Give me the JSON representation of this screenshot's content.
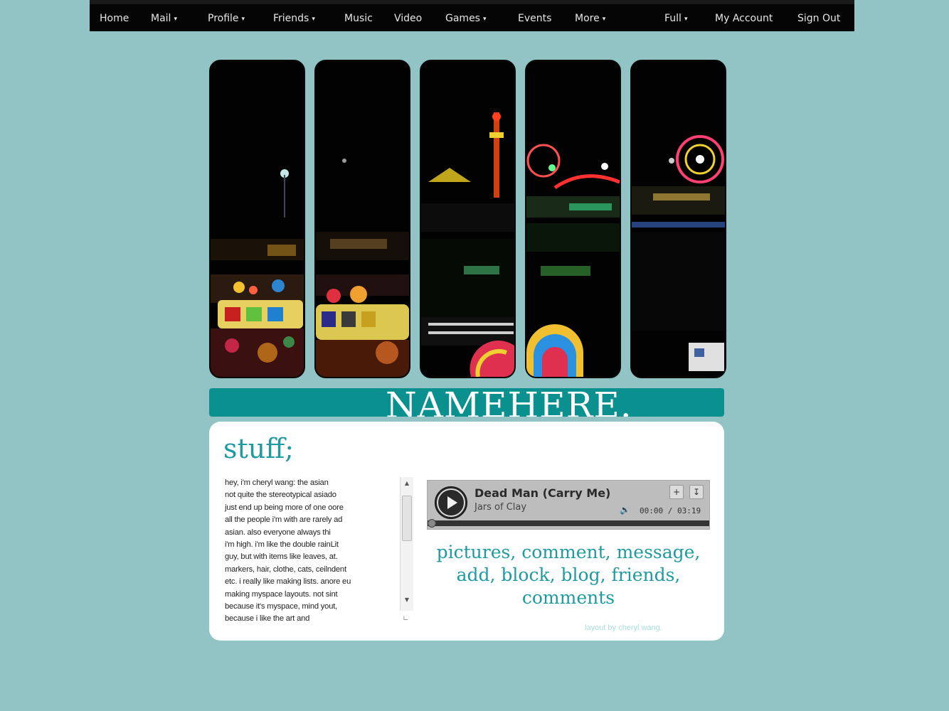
{
  "nav": {
    "left_items": [
      {
        "label": "Home",
        "caret": ""
      },
      {
        "label": "Mail",
        "caret": "▾"
      },
      {
        "label": "Profile",
        "caret": "▾"
      },
      {
        "label": "Friends",
        "caret": "▾"
      },
      {
        "label": "Music",
        "caret": ""
      },
      {
        "label": "Video",
        "caret": ""
      },
      {
        "label": "Games",
        "caret": "▾"
      },
      {
        "label": "Events",
        "caret": ""
      },
      {
        "label": "More",
        "caret": "▾"
      }
    ],
    "right_items": [
      {
        "label": "Full",
        "caret": "▾"
      },
      {
        "label": "My Account",
        "caret": ""
      },
      {
        "label": "Sign Out",
        "caret": ""
      }
    ]
  },
  "banner": {
    "name": "NAMEHERE."
  },
  "panel": {
    "heading": "stuff;",
    "about_text": "hey, i'm cheryl wang: the asian\nnot quite the stereotypical asiado\njust end up being more of one oore\nall the people i'm with are rarely ad\nasian. also everyone always thi\ni'm high. i'm like the double rainLit\nguy, but with items like leaves, at.\nmarkers, hair, clothe, cats, ceilndent\netc. i really like making lists. anore eu\nmaking myspace layouts. not    sint\nbecause it's myspace, mind yout,\nbecause i like the art and",
    "credit": "layout by cheryl wang."
  },
  "player": {
    "song_title": "Dead Man (Carry Me)",
    "artist": "Jars of Clay",
    "time": "00:00 / 03:19",
    "add_icon": "plus-icon",
    "download_icon": "download-icon",
    "volume_icon": "speaker-icon"
  },
  "links": {
    "pictures": "pictures,",
    "comment": "comment,",
    "message": "message,",
    "add": "add,",
    "block": "block,",
    "blog": "blog,",
    "friends": "friends,",
    "comments": "comments"
  },
  "colors": {
    "background": "#92c4c6",
    "banner": "#0b9090",
    "accent_text": "#1f9aa0",
    "nav_bg": "#050505"
  }
}
